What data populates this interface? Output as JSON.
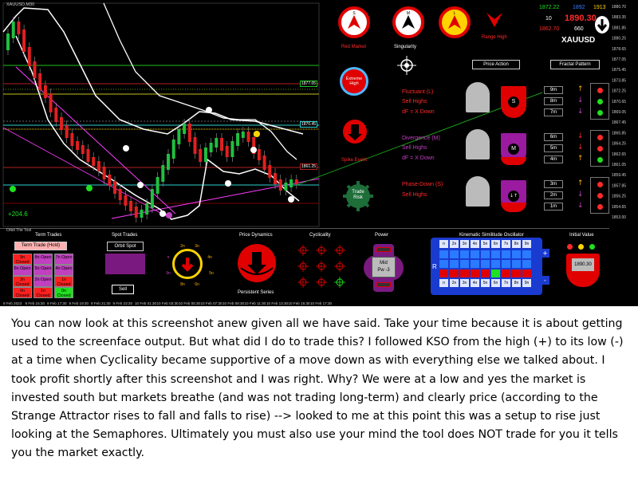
{
  "chart": {
    "symbol_title": "XAUUSD,M30",
    "window_caption": "Orbit The Tool",
    "price_ticks": [
      "1880.70",
      "1883.35",
      "1881.85",
      "1880.25",
      "1878.65",
      "1877.05",
      "1875.45",
      "1873.85",
      "1872.25",
      "1870.65",
      "1869.05",
      "1867.45",
      "1865.85",
      "1864.25",
      "1862.65",
      "1861.05",
      "1859.45",
      "1857.85",
      "1856.25",
      "1854.65",
      "1853.00"
    ],
    "level_labels": [
      "1877.05",
      "1870.45",
      "1861.25"
    ],
    "pips_label": "+204.6",
    "dates": [
      "9 Feb 2023",
      "9 Feb 15:30",
      "9 Feb 17:30",
      "9 Feb 19:30",
      "9 Feb 21:30",
      "9 Feb 23:30",
      "10 Feb 01:30",
      "10 Feb 03:30",
      "10 Feb 05:30",
      "10 Feb 07:30",
      "10 Feb 09:30",
      "10 Feb 11:30",
      "10 Feb 13:30",
      "10 Feb 15:30",
      "10 Feb 17:30"
    ]
  },
  "quote": {
    "bid_left": "1872.22",
    "bid_mid": "1892",
    "bid_right": "1913",
    "spread": "10",
    "big_price": "1890.30",
    "low_left": "1862.70",
    "low_right": "660",
    "symbol": "XAUUSD"
  },
  "signals": {
    "ring_s": "S",
    "ring_m": "M",
    "ring_l": "L",
    "range_high": "Range High",
    "red_market": "Red Market",
    "singularity": "Singularity",
    "extreme_high": "Extreme High",
    "spike_event": "Spike Event",
    "trade_risk": "Trade Risk",
    "fluctuant": "Fluctuant (L)",
    "fluct_sell": "Sell Highs",
    "fluct_df": "dF = X Down",
    "divergence": "Divergence (M)",
    "div_sell": "Sell Highs",
    "div_df": "dF = X Down",
    "phase_down": "Phase-Down (S)",
    "phase_sell": "Sell Highs",
    "price_action": "Price Action",
    "fractal_pattern": "Fractal Pattern",
    "badge_s": "S",
    "badge_m": "M",
    "tf": [
      "9m",
      "8m",
      "7m",
      "6m",
      "5m",
      "4m",
      "3m",
      "2m",
      "1m"
    ]
  },
  "panel": {
    "term_trades": "Term Trades",
    "term_trade_hold": "Term Trade (Hold)",
    "term_tiles": [
      "9n Closed",
      "8n Open",
      "7n Open",
      "6n Open",
      "5n Open",
      "4n Open",
      "3n Closed",
      "2n Open",
      "1n Closed",
      "0n Closed",
      "1n Closed",
      "0n Closed"
    ],
    "spot_trades": "Spot Trades",
    "orbit_spot": "Orbit Spot",
    "sell": "Sell",
    "orbit_labels": [
      "n",
      "2n",
      "3n",
      "4n",
      "5n",
      "6n",
      "8n",
      "9n"
    ],
    "price_dynamics": "Price Dynamics",
    "persistent_series": "Persistent Series",
    "cyclicality": "Cyclicality",
    "power": "Power",
    "power_mid": "Mid",
    "power_pw": "Pw -3",
    "kso_title": "Kinematic Similitude Oscillator",
    "kso_cols": [
      "n",
      "2n",
      "3n",
      "4n",
      "5n",
      "6n",
      "7n",
      "8n",
      "9n"
    ],
    "kso_r": "R",
    "kso_plus": "+",
    "kso_minus": "-",
    "initial_value": "Initial Value",
    "initial_price": "1890.30"
  },
  "caption": "You can now look at this screenshot anew given all we have said. Take your time because it is about getting used to the screenface output. But what did I do to trade this? I followed KSO from the high (+) to its low (-) at a time when Cyclicality became supportive of a move down as with everything else we talked about. I took profit shortly after this screenshot and I was right. Why? We were at a low and yes the market is invested south but markets breathe (and was not trading long-term) and clearly price (according to the Strange Attractor rises to fall and falls to rise) --> looked to me at this point this was a setup to rise just looking at the Semaphores. Ultimately you must also use your mind the tool does NOT trade for you it tells you the market exactly."
}
